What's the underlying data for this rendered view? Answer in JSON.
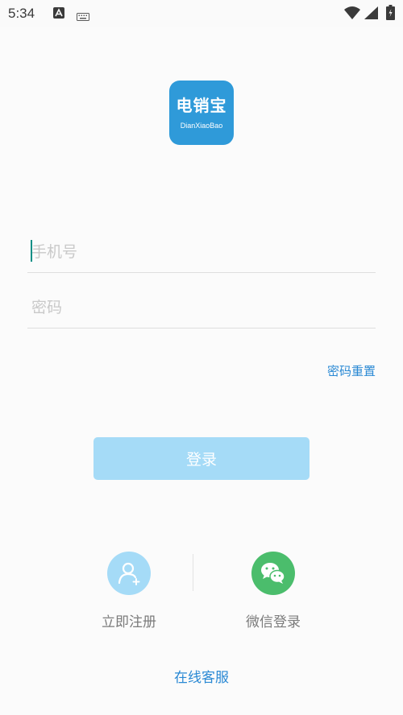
{
  "status_bar": {
    "time": "5:34",
    "icons": [
      "notification-a-icon",
      "keyboard-icon",
      "wifi-icon",
      "signal-icon",
      "battery-icon"
    ]
  },
  "logo": {
    "title": "电销宝",
    "subtitle": "DianXiaoBao",
    "color": "#2f9ad9"
  },
  "form": {
    "phone": {
      "value": "",
      "placeholder": "手机号"
    },
    "password": {
      "value": "",
      "placeholder": "密码"
    },
    "reset_label": "密码重置",
    "login_label": "登录"
  },
  "options": {
    "register_label": "立即注册",
    "wechat_label": "微信登录"
  },
  "footer": {
    "service_label": "在线客服"
  },
  "colors": {
    "accent": "#2a89d4",
    "login_button": "#a5dbf7",
    "register_icon_bg": "#a5dbf7",
    "wechat_icon_bg": "#4bbd6c",
    "cursor": "#0b8f86"
  }
}
